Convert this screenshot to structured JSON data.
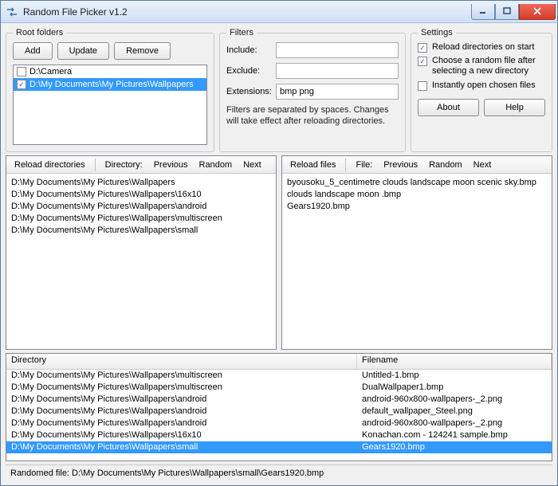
{
  "window": {
    "title": "Random File Picker v1.2"
  },
  "root": {
    "legend": "Root folders",
    "add": "Add",
    "update": "Update",
    "remove": "Remove",
    "items": [
      {
        "path": "D:\\Camera",
        "checked": false,
        "selected": false
      },
      {
        "path": "D:\\My Documents\\My Pictures\\Wallpapers",
        "checked": true,
        "selected": true
      }
    ]
  },
  "filters": {
    "legend": "Filters",
    "include_label": "Include:",
    "include_value": "",
    "exclude_label": "Exclude:",
    "exclude_value": "",
    "extensions_label": "Extensions:",
    "extensions_value": "bmp png",
    "hint": "Filters are separated by spaces. Changes will take effect after reloading directories."
  },
  "settings": {
    "legend": "Settings",
    "reload_on_start": {
      "label": "Reload directories on start",
      "checked": true
    },
    "random_after_select": {
      "label": "Choose a random file after selecting a new directory",
      "checked": true
    },
    "instant_open": {
      "label": "Instantly open chosen files",
      "checked": false
    },
    "about": "About",
    "help": "Help"
  },
  "dirs_panel": {
    "reload": "Reload directories",
    "label": "Directory:",
    "prev": "Previous",
    "random": "Random",
    "next": "Next",
    "rows": [
      "D:\\My Documents\\My Pictures\\Wallpapers",
      "D:\\My Documents\\My Pictures\\Wallpapers\\16x10",
      "D:\\My Documents\\My Pictures\\Wallpapers\\android",
      "D:\\My Documents\\My Pictures\\Wallpapers\\multiscreen",
      "D:\\My Documents\\My Pictures\\Wallpapers\\small"
    ]
  },
  "files_panel": {
    "reload": "Reload files",
    "label": "File:",
    "prev": "Previous",
    "random": "Random",
    "next": "Next",
    "rows": [
      "byousoku_5_centimetre clouds landscape moon scenic sky.bmp",
      "clouds landscape moon .bmp",
      "Gears1920.bmp"
    ]
  },
  "table": {
    "headers": {
      "dir": "Directory",
      "file": "Filename"
    },
    "rows": [
      {
        "dir": "D:\\My Documents\\My Pictures\\Wallpapers\\multiscreen",
        "file": "Untitled-1.bmp",
        "selected": false
      },
      {
        "dir": "D:\\My Documents\\My Pictures\\Wallpapers\\multiscreen",
        "file": "DualWallpaper1.bmp",
        "selected": false
      },
      {
        "dir": "D:\\My Documents\\My Pictures\\Wallpapers\\android",
        "file": "android-960x800-wallpapers-_2.png",
        "selected": false
      },
      {
        "dir": "D:\\My Documents\\My Pictures\\Wallpapers\\android",
        "file": "default_wallpaper_Steel.png",
        "selected": false
      },
      {
        "dir": "D:\\My Documents\\My Pictures\\Wallpapers\\android",
        "file": "android-960x800-wallpapers-_2.png",
        "selected": false
      },
      {
        "dir": "D:\\My Documents\\My Pictures\\Wallpapers\\16x10",
        "file": "Konachan.com - 124241 sample.bmp",
        "selected": false
      },
      {
        "dir": "D:\\My Documents\\My Pictures\\Wallpapers\\small",
        "file": "Gears1920.bmp",
        "selected": true
      }
    ]
  },
  "status": "Randomed file: D:\\My Documents\\My Pictures\\Wallpapers\\small\\Gears1920.bmp"
}
